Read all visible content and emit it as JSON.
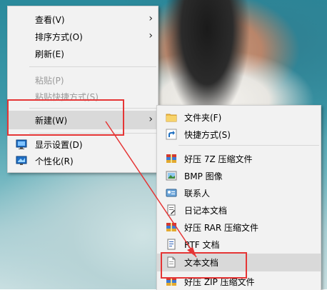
{
  "context_menu": {
    "items": [
      {
        "label": "查看(V)",
        "has_submenu": true
      },
      {
        "label": "排序方式(O)",
        "has_submenu": true
      },
      {
        "label": "刷新(E)"
      },
      {
        "label": "粘贴(P)",
        "disabled": true
      },
      {
        "label": "粘贴快捷方式(S)",
        "disabled": true
      },
      {
        "label": "新建(W)",
        "has_submenu": true,
        "highlighted": true
      },
      {
        "label": "显示设置(D)",
        "icon": "display-settings-icon"
      },
      {
        "label": "个性化(R)",
        "icon": "personalize-icon"
      }
    ]
  },
  "new_submenu": {
    "items": [
      {
        "label": "文件夹(F)",
        "icon": "folder-icon"
      },
      {
        "label": "快捷方式(S)",
        "icon": "shortcut-icon"
      },
      {
        "label": "好压 7Z 压缩文件",
        "icon": "archive-icon"
      },
      {
        "label": "BMP 图像",
        "icon": "bmp-image-icon"
      },
      {
        "label": "联系人",
        "icon": "contact-icon"
      },
      {
        "label": "日记本文档",
        "icon": "journal-icon"
      },
      {
        "label": "好压 RAR 压缩文件",
        "icon": "archive-icon"
      },
      {
        "label": "RTF 文档",
        "icon": "rtf-document-icon"
      },
      {
        "label": "文本文档",
        "icon": "text-document-icon",
        "highlighted": true
      },
      {
        "label": "好压 ZIP 压缩文件",
        "icon": "archive-icon"
      }
    ]
  },
  "annotation_color": "#e53535"
}
